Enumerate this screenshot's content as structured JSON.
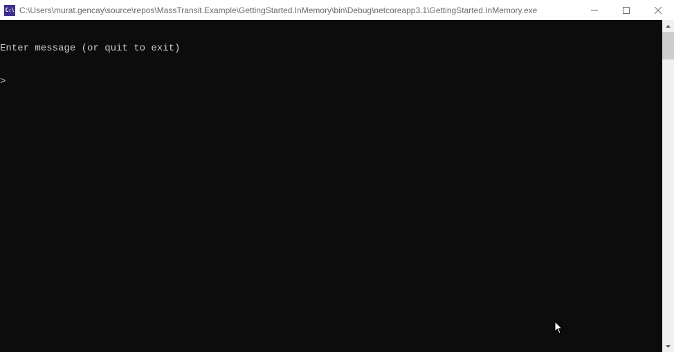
{
  "titlebar": {
    "icon_label": "C:\\",
    "path": "C:\\Users\\murat.gencay\\source\\repos\\MassTransit.Example\\GettingStarted.InMemory\\bin\\Debug\\netcoreapp3.1\\GettingStarted.InMemory.exe"
  },
  "controls": {
    "minimize": "minimize",
    "maximize": "maximize",
    "close": "close"
  },
  "console": {
    "lines": [
      "Enter message (or quit to exit)",
      ">"
    ]
  }
}
